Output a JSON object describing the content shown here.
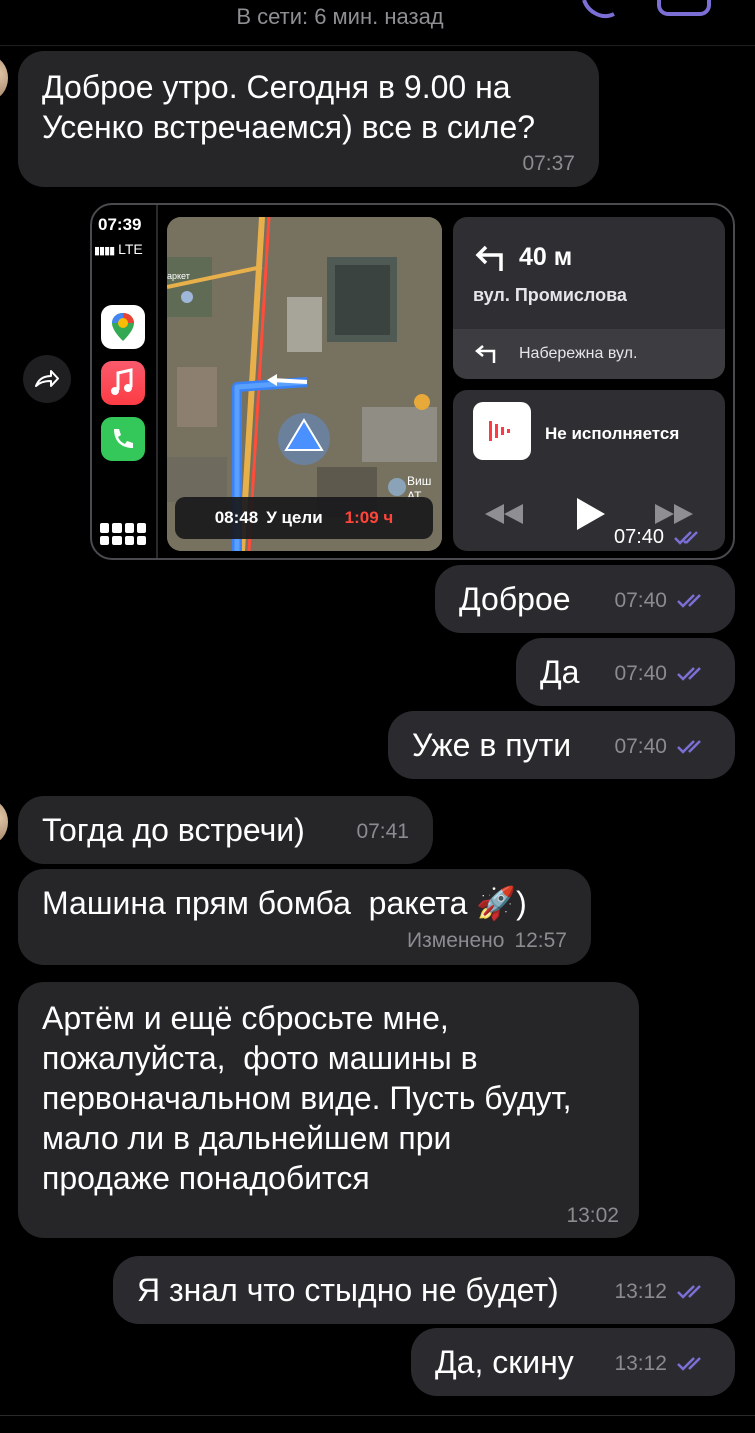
{
  "header": {
    "status": "В сети: 6 мин. назад"
  },
  "messages": [
    {
      "dir": "in",
      "text": "Доброе утро. Сегодня в 9.00 на\nУсенко встречаемся) все в силе?",
      "time": "07:37"
    },
    {
      "dir": "out",
      "text": "Доброе",
      "time": "07:40"
    },
    {
      "dir": "out",
      "text": "Да",
      "time": "07:40"
    },
    {
      "dir": "out",
      "text": "Уже в пути",
      "time": "07:40"
    },
    {
      "dir": "in",
      "text": "Тогда до встречи)",
      "time": "07:41"
    },
    {
      "dir": "in",
      "text": "Машина прям бомба  ракета 🚀)",
      "edited": "Изменено",
      "time": "12:57"
    },
    {
      "dir": "in",
      "text": "Артём и ещё сбросьте мне,\nпожалуйста,  фото машины в\nпервоначальном виде. Пусть будут,\nмало ли в дальнейшем при\nпродаже понадобится",
      "time": "13:02"
    },
    {
      "dir": "out",
      "text": "Я знал что стыдно не будет)",
      "time": "13:12"
    },
    {
      "dir": "out",
      "text": "Да, скину",
      "time": "13:12"
    }
  ],
  "image_message": {
    "time": "07:40",
    "carplay": {
      "clock": "07:39",
      "network": "LTE",
      "apps": [
        "google-maps-icon",
        "music-icon",
        "phone-icon"
      ],
      "eta_time": "08:48",
      "eta_label": "У цели",
      "eta_remaining": "1:09 ч",
      "turn_distance": "40 м",
      "turn_street": "вул. Промислова",
      "next_street": "Набережна вул.",
      "music_status": "Не исполняется",
      "map_labels": [
        "аркет",
        "Виш",
        "АТ"
      ]
    }
  },
  "colors": {
    "bubble_out": "#2b2b2f",
    "bubble_in": "#262629",
    "read_ticks": "#7b6fd6",
    "time_text": "#8b8b90",
    "eta_red": "#ff453a",
    "music_red": "#fc3c44"
  }
}
